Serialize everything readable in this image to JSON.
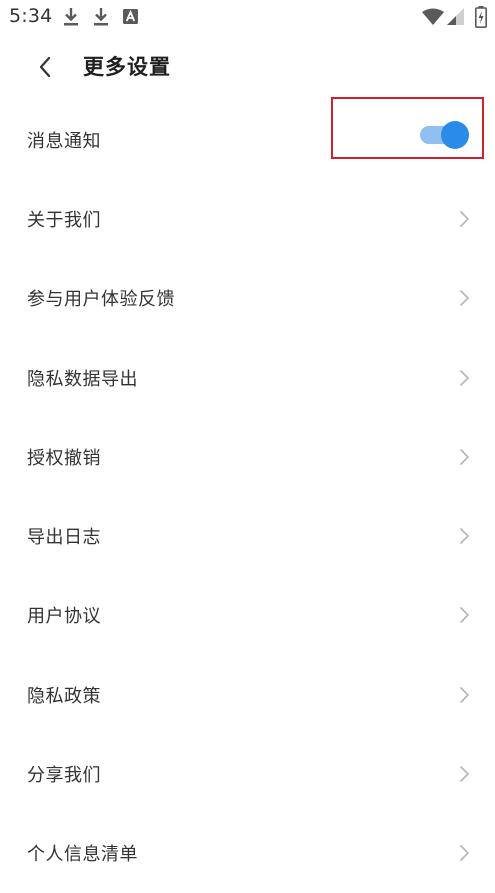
{
  "status_bar": {
    "time": "5:34",
    "left_icons": [
      "download-icon",
      "download-icon",
      "app-notification-icon"
    ],
    "right_icons": [
      "wifi-icon",
      "signal-icon",
      "battery-charging-icon"
    ]
  },
  "header": {
    "back_icon": "chevron-left-icon",
    "title": "更多设置"
  },
  "settings": {
    "items": [
      {
        "label": "消息通知",
        "control": "toggle",
        "checked": true
      },
      {
        "label": "关于我们",
        "control": "chevron"
      },
      {
        "label": "参与用户体验反馈",
        "control": "chevron"
      },
      {
        "label": "隐私数据导出",
        "control": "chevron"
      },
      {
        "label": "授权撤销",
        "control": "chevron"
      },
      {
        "label": "导出日志",
        "control": "chevron"
      },
      {
        "label": "用户协议",
        "control": "chevron"
      },
      {
        "label": "隐私政策",
        "control": "chevron"
      },
      {
        "label": "分享我们",
        "control": "chevron"
      },
      {
        "label": "个人信息清单",
        "control": "chevron"
      }
    ]
  },
  "colors": {
    "toggle_on_track": "#90bff0",
    "toggle_on_knob": "#2b8be8",
    "highlight_border": "#d0202c",
    "chevron": "#b8b8b8"
  }
}
